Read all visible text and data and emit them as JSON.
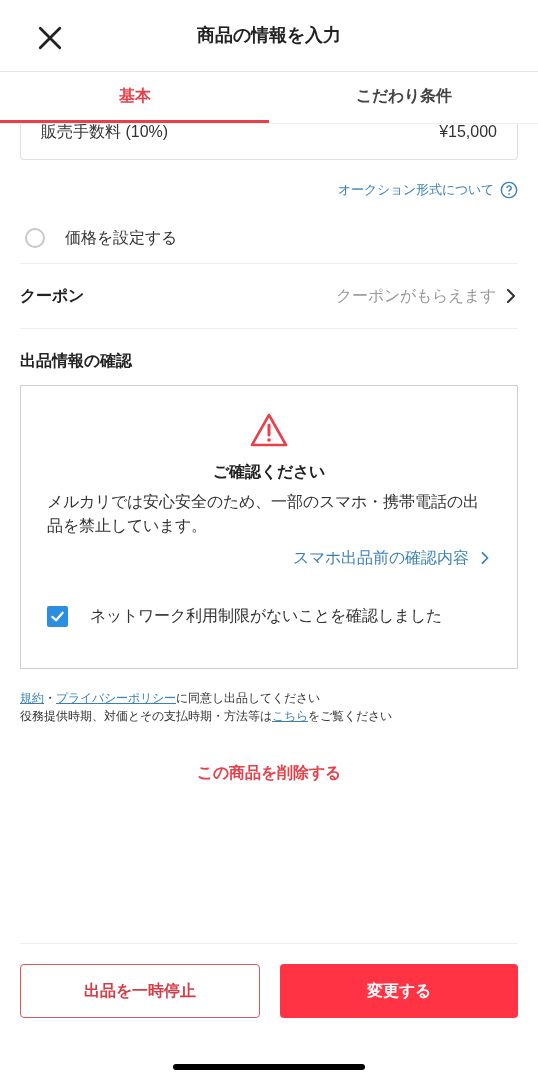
{
  "header": {
    "title": "商品の情報を入力"
  },
  "tabs": [
    {
      "label": "基本",
      "selected": true
    },
    {
      "label": "こだわり条件",
      "selected": false
    }
  ],
  "fee_row": {
    "label": "販売手数料 (10%)",
    "value": "¥15,000"
  },
  "auction_link": "オークション形式について",
  "price_option": {
    "label": "価格を設定する",
    "selected": false
  },
  "coupon": {
    "label": "クーポン",
    "value": "クーポンがもらえます"
  },
  "confirmation": {
    "heading": "出品情報の確認",
    "title": "ご確認ください",
    "message": "メルカリでは安心安全のため、一部のスマホ・携帯電話の出品を禁止しています。",
    "link": "スマホ出品前の確認内容",
    "checkbox": {
      "label": "ネットワーク利用制限がないことを確認しました",
      "checked": true
    }
  },
  "terms": [
    [
      {
        "text": "規約",
        "link": true
      },
      {
        "text": "・",
        "link": false
      },
      {
        "text": "プライバシーポリシー",
        "link": true
      },
      {
        "text": "に同意し出品してください",
        "link": false
      }
    ],
    [
      {
        "text": "役務提供時期、対価とその支払時期・方法等は",
        "link": false
      },
      {
        "text": "こちら",
        "link": true
      },
      {
        "text": "をご覧ください",
        "link": false
      }
    ]
  ],
  "delete_link": "この商品を削除する",
  "buttons": [
    {
      "label": "出品を一時停止",
      "kind": "outline"
    },
    {
      "label": "変更する",
      "kind": "primary"
    }
  ]
}
